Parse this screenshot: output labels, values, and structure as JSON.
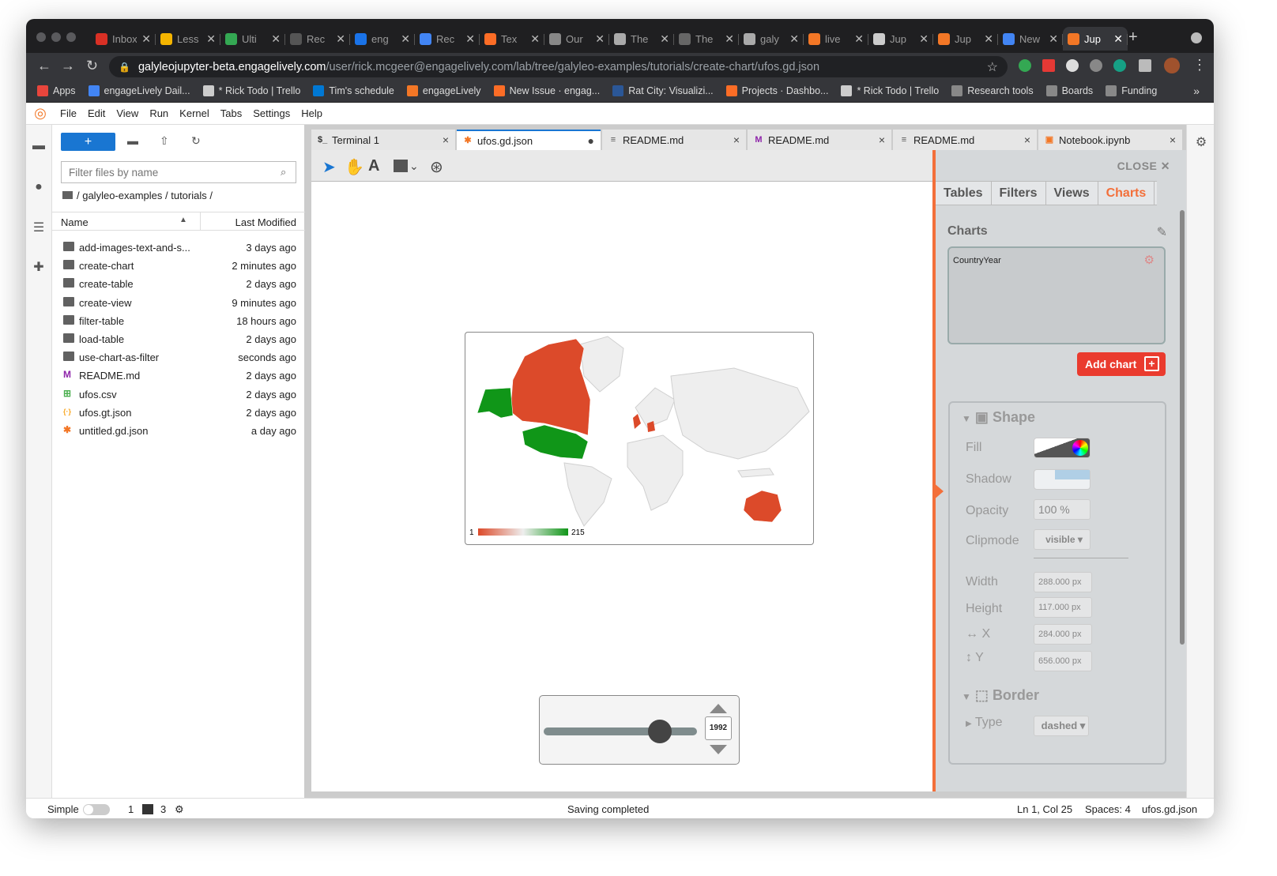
{
  "browser": {
    "tabs": [
      {
        "label": "Inbox",
        "color": "#d93025"
      },
      {
        "label": "Less",
        "color": "#f4b400"
      },
      {
        "label": "Ulti",
        "color": "#34a853"
      },
      {
        "label": "Rec",
        "color": "#555"
      },
      {
        "label": "eng",
        "color": "#1a73e8"
      },
      {
        "label": "Rec",
        "color": "#4285f4"
      },
      {
        "label": "Tex",
        "color": "#fc6d26"
      },
      {
        "label": "Our",
        "color": "#888"
      },
      {
        "label": "The",
        "color": "#aaa"
      },
      {
        "label": "The",
        "color": "#666"
      },
      {
        "label": "galy",
        "color": "#aaa"
      },
      {
        "label": "live",
        "color": "#f37726"
      },
      {
        "label": "Jup",
        "color": "#ccc"
      },
      {
        "label": "Jup",
        "color": "#f37726"
      },
      {
        "label": "New",
        "color": "#4285f4"
      },
      {
        "label": "Jup",
        "color": "#f37726"
      }
    ],
    "url_host": "galyleojupyter-beta.engagelively.com",
    "url_path": "/user/rick.mcgeer@engagelively.com/lab/tree/galyleo-examples/tutorials/create-chart/ufos.gd.json",
    "bookmarks": [
      {
        "label": "Apps",
        "color": "#e8453c"
      },
      {
        "label": "engageLively Dail...",
        "color": "#4285f4"
      },
      {
        "label": "* Rick Todo | Trello",
        "color": "#ccc"
      },
      {
        "label": "Tim's schedule",
        "color": "#0078d4"
      },
      {
        "label": "engageLively",
        "color": "#f37726"
      },
      {
        "label": "New Issue · engag...",
        "color": "#fc6d26"
      },
      {
        "label": "Rat City: Visualizi...",
        "color": "#2b5797"
      },
      {
        "label": "Projects · Dashbo...",
        "color": "#fc6d26"
      },
      {
        "label": "* Rick Todo | Trello",
        "color": "#ccc"
      },
      {
        "label": "Research tools",
        "color": "#888"
      },
      {
        "label": "Boards",
        "color": "#888"
      },
      {
        "label": "Funding",
        "color": "#888"
      }
    ],
    "more": "»"
  },
  "menubar": [
    "File",
    "Edit",
    "View",
    "Run",
    "Kernel",
    "Tabs",
    "Settings",
    "Help"
  ],
  "filebrowser": {
    "new_label": "+",
    "filter_placeholder": "Filter files by name",
    "breadcrumb": "/ galyleo-examples / tutorials /",
    "col_name": "Name",
    "col_modified": "Last Modified",
    "files": [
      {
        "name": "add-images-text-and-s...",
        "modified": "3 days ago",
        "kind": "folder"
      },
      {
        "name": "create-chart",
        "modified": "2 minutes ago",
        "kind": "folder"
      },
      {
        "name": "create-table",
        "modified": "2 days ago",
        "kind": "folder"
      },
      {
        "name": "create-view",
        "modified": "9 minutes ago",
        "kind": "folder"
      },
      {
        "name": "filter-table",
        "modified": "18 hours ago",
        "kind": "folder"
      },
      {
        "name": "load-table",
        "modified": "2 days ago",
        "kind": "folder"
      },
      {
        "name": "use-chart-as-filter",
        "modified": "seconds ago",
        "kind": "folder"
      },
      {
        "name": "README.md",
        "modified": "2 days ago",
        "kind": "markdown"
      },
      {
        "name": "ufos.csv",
        "modified": "2 days ago",
        "kind": "csv"
      },
      {
        "name": "ufos.gt.json",
        "modified": "2 days ago",
        "kind": "json"
      },
      {
        "name": "untitled.gd.json",
        "modified": "a day ago",
        "kind": "galyleo"
      }
    ]
  },
  "editor_tabs": [
    {
      "label": "Terminal 1",
      "icon": "$_",
      "color": "#333",
      "close": "×",
      "active": false
    },
    {
      "label": "ufos.gd.json",
      "icon": "✱",
      "color": "#f37726",
      "close": "●",
      "active": true
    },
    {
      "label": "README.md",
      "icon": "≡",
      "color": "#555",
      "close": "×",
      "active": false
    },
    {
      "label": "README.md",
      "icon": "M",
      "color": "#8e24aa",
      "close": "×",
      "active": false
    },
    {
      "label": "README.md",
      "icon": "≡",
      "color": "#555",
      "close": "×",
      "active": false
    },
    {
      "label": "Notebook.ipynb",
      "icon": "▣",
      "color": "#f37726",
      "close": "×",
      "active": false
    }
  ],
  "map": {
    "legend_min": "1",
    "legend_max": "215",
    "low_color": "#dc4a2a",
    "high_color": "#109618"
  },
  "slider": {
    "value": "1992",
    "fraction": 0.76
  },
  "panel": {
    "close": "CLOSE",
    "tabs": [
      "Tables",
      "Filters",
      "Views",
      "Charts"
    ],
    "active_tab": "Charts",
    "title": "Charts",
    "chart_item": "CountryYear",
    "add_chart": "Add chart",
    "shape_title": "Shape",
    "fill_label": "Fill",
    "shadow_label": "Shadow",
    "opacity_label": "Opacity",
    "opacity_value": "100 %",
    "clipmode_label": "Clipmode",
    "clipmode_value": "visible",
    "width_label": "Width",
    "width_value": "288.000",
    "height_label": "Height",
    "height_value": "117.000",
    "x_label": "X",
    "x_value": "284.000",
    "y_label": "Y",
    "y_value": "656.000",
    "unit": "px",
    "border_title": "Border",
    "type_label": "Type",
    "type_value": "dashed"
  },
  "status": {
    "mode": "Simple",
    "kernels": "1",
    "terminals": "3",
    "message": "Saving completed",
    "position": "Ln 1, Col 25",
    "spaces": "Spaces: 4",
    "file": "ufos.gd.json"
  }
}
